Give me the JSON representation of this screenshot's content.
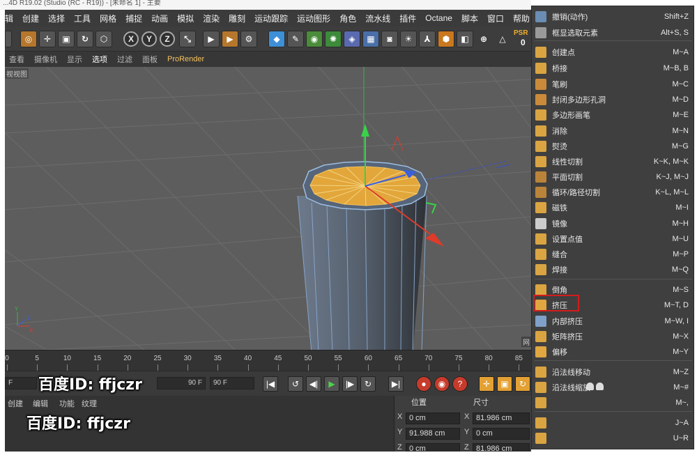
{
  "window_title": "...4D R19.02 (Studio (RC - R19)) - [未命名 1] - 主要",
  "menu": [
    "辑",
    "创建",
    "选择",
    "工具",
    "网格",
    "捕捉",
    "动画",
    "模拟",
    "渲染",
    "雕刻",
    "运动跟踪",
    "运动图形",
    "角色",
    "流水线",
    "插件",
    "Octane",
    "脚本",
    "窗口",
    "帮助"
  ],
  "toolbar": {
    "axis_x": "X",
    "axis_y": "Y",
    "axis_z": "Z",
    "psr_label": "PSR",
    "psr_value": "0"
  },
  "view_menu": [
    "查看",
    "摄像机",
    "显示",
    "选项",
    "过滤",
    "面板",
    "ProRender"
  ],
  "viewport": {
    "label": "视视图",
    "corner": "网"
  },
  "timeline": {
    "ticks": [
      "0",
      "5",
      "10",
      "15",
      "20",
      "25",
      "30",
      "35",
      "40",
      "45",
      "50",
      "55",
      "60",
      "65",
      "70",
      "75",
      "80",
      "85"
    ]
  },
  "transport": {
    "start": "F",
    "end_field": "90 F",
    "end_field2": "90 F"
  },
  "bottom": {
    "tabs": [
      "创建",
      "编辑",
      "功能",
      "纹理"
    ],
    "coord": {
      "pos_header": "位置",
      "size_header": "尺寸",
      "rows": [
        {
          "axis": "X",
          "pos": "0 cm",
          "axis2": "X",
          "size": "81.986 cm"
        },
        {
          "axis": "Y",
          "pos": "91.988 cm",
          "axis2": "Y",
          "size": "0 cm"
        },
        {
          "axis": "Z",
          "pos": "0 cm",
          "axis2": "Z",
          "size": "81.986 cm"
        }
      ]
    }
  },
  "watermarks": [
    "百度ID: ffjczr",
    "百度ID: ffjczr"
  ],
  "context_menu": {
    "items": [
      {
        "label": "撤销(动作)",
        "shortcut": "Shift+Z",
        "icon": "undo-icon",
        "color": "#6a8db3"
      },
      {
        "label": "框显选取元素",
        "shortcut": "Alt+S, S",
        "icon": "frame-selection-icon",
        "color": "#9a9a9a"
      },
      {
        "label": "创建点",
        "shortcut": "M~A",
        "icon": "create-point-icon",
        "color": "#d9a441"
      },
      {
        "label": "桥接",
        "shortcut": "M~B, B",
        "icon": "bridge-icon",
        "color": "#d9a441"
      },
      {
        "label": "笔刷",
        "shortcut": "M~C",
        "icon": "brush-icon",
        "color": "#c98a3a"
      },
      {
        "label": "封闭多边形孔洞",
        "shortcut": "M~D",
        "icon": "close-hole-icon",
        "color": "#c98a3a"
      },
      {
        "label": "多边形画笔",
        "shortcut": "M~E",
        "icon": "polygon-pen-icon",
        "color": "#d9a441"
      },
      {
        "label": "消除",
        "shortcut": "M~N",
        "icon": "dissolve-icon",
        "color": "#d9a441"
      },
      {
        "label": "熨烫",
        "shortcut": "M~G",
        "icon": "iron-icon",
        "color": "#d9a441"
      },
      {
        "label": "线性切割",
        "shortcut": "K~K, M~K",
        "icon": "knife-icon",
        "color": "#d9a441"
      },
      {
        "label": "平面切割",
        "shortcut": "K~J, M~J",
        "icon": "plane-cut-icon",
        "color": "#b9843a"
      },
      {
        "label": "循环/路径切割",
        "shortcut": "K~L, M~L",
        "icon": "loop-cut-icon",
        "color": "#b9843a"
      },
      {
        "label": "磁铁",
        "shortcut": "M~I",
        "icon": "magnet-icon",
        "color": "#d9a441"
      },
      {
        "label": "镜像",
        "shortcut": "M~H",
        "icon": "mirror-icon",
        "color": "#cccccc"
      },
      {
        "label": "设置点值",
        "shortcut": "M~U",
        "icon": "set-point-value-icon",
        "color": "#d9a441"
      },
      {
        "label": "缝合",
        "shortcut": "M~P",
        "icon": "stitch-icon",
        "color": "#d9a441"
      },
      {
        "label": "焊接",
        "shortcut": "M~Q",
        "icon": "weld-icon",
        "color": "#d9a441"
      },
      {
        "label": "倒角",
        "shortcut": "M~S",
        "icon": "bevel-icon",
        "color": "#d9a441"
      },
      {
        "label": "挤压",
        "shortcut": "M~T, D",
        "icon": "extrude-icon",
        "color": "#e0a640"
      },
      {
        "label": "内部挤压",
        "shortcut": "M~W, I",
        "icon": "inner-extrude-icon",
        "color": "#7fa0c8"
      },
      {
        "label": "矩阵挤压",
        "shortcut": "M~X",
        "icon": "matrix-extrude-icon",
        "color": "#d9a441"
      },
      {
        "label": "偏移",
        "shortcut": "M~Y",
        "icon": "offset-icon",
        "color": "#e0a640"
      },
      {
        "label": "沿法线移动",
        "shortcut": "M~Z",
        "icon": "normal-move-icon",
        "color": "#d9a441"
      },
      {
        "label": "沿法线缩放",
        "shortcut": "M~#",
        "icon": "normal-scale-icon",
        "color": "#d9a441"
      },
      {
        "label": "",
        "shortcut": "M~,",
        "icon": "normal-rotate-icon",
        "color": "#d9a441"
      },
      {
        "label": "",
        "shortcut": "J~A",
        "icon": "align-normals-icon",
        "color": "#d9a441"
      },
      {
        "label": "",
        "shortcut": "U~R",
        "icon": "reverse-normals-icon",
        "color": "#d9a441"
      }
    ]
  }
}
